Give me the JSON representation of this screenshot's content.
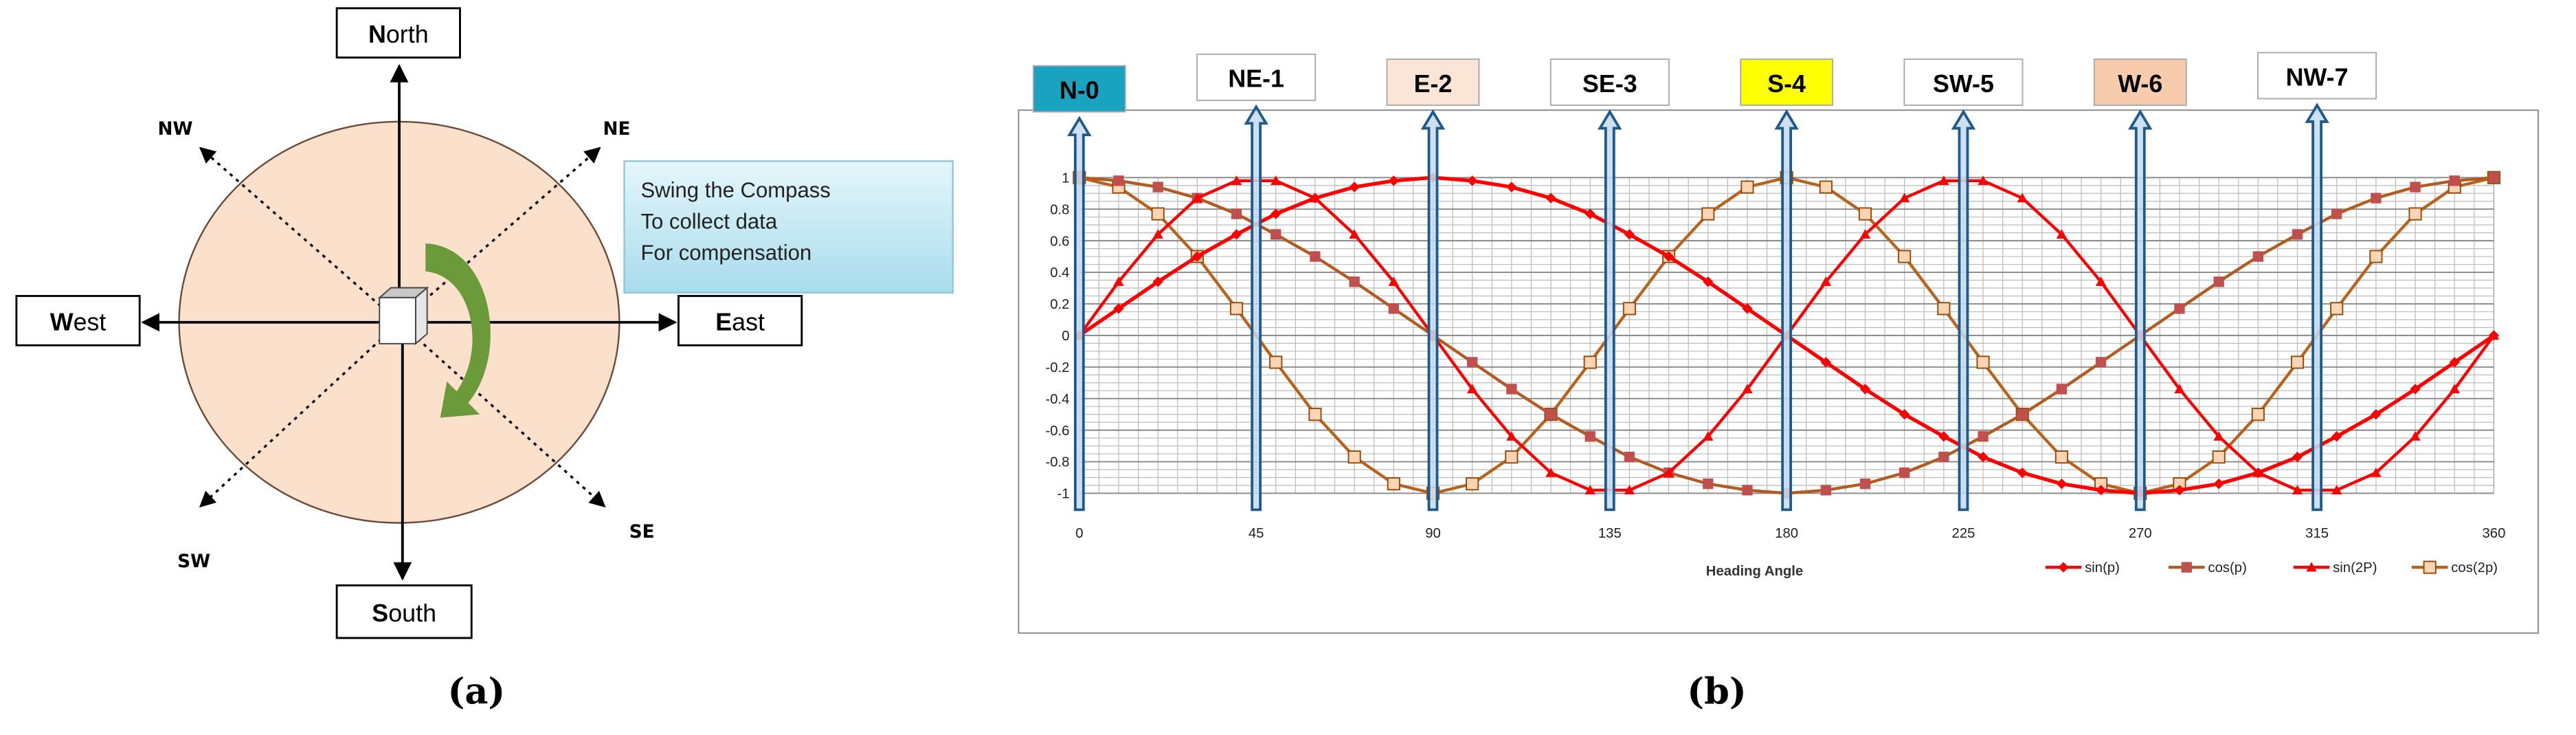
{
  "panel_a": {
    "caption": "(a)",
    "directions": {
      "north": {
        "first": "N",
        "rest": "orth"
      },
      "south": {
        "first": "S",
        "rest": "outh"
      },
      "east": {
        "first": "E",
        "rest": "ast"
      },
      "west": {
        "first": "W",
        "rest": "est"
      }
    },
    "diagonals": {
      "nw": "NW",
      "ne": "NE",
      "sw": "SW",
      "se": "SE"
    },
    "callout": [
      "Swing the Compass",
      "To collect data",
      "For compensation"
    ],
    "colors": {
      "disc": "#fbe0cc",
      "rotation_arrow": "#6a9a3a",
      "callout": "#bfe6f2"
    }
  },
  "panel_b": {
    "caption": "(b)"
  },
  "chart_data": {
    "type": "line",
    "title": "",
    "xlabel": "Heading Angle",
    "ylabel": "",
    "xlim": [
      0,
      360
    ],
    "ylim": [
      -1,
      1
    ],
    "x_ticks": [
      "0",
      "45",
      "90",
      "135",
      "180",
      "225",
      "270",
      "315",
      "360"
    ],
    "y_ticks": [
      "1",
      "0.8",
      "0.6",
      "0.4",
      "0.2",
      "0",
      "-0.2",
      "-0.4",
      "-0.6",
      "-0.8",
      "-1"
    ],
    "grid": true,
    "legend": "bottom-right",
    "x": [
      0,
      10,
      20,
      30,
      40,
      50,
      60,
      70,
      80,
      90,
      100,
      110,
      120,
      130,
      140,
      150,
      160,
      170,
      180,
      190,
      200,
      210,
      220,
      230,
      240,
      250,
      260,
      270,
      280,
      290,
      300,
      310,
      320,
      330,
      340,
      350,
      360
    ],
    "series": [
      {
        "name": "sin(p)",
        "marker": "diamond",
        "color": "#ff0000",
        "marker_fill": "#ff0000",
        "values": [
          0,
          0.17,
          0.34,
          0.5,
          0.64,
          0.77,
          0.87,
          0.94,
          0.98,
          1,
          0.98,
          0.94,
          0.87,
          0.77,
          0.64,
          0.5,
          0.34,
          0.17,
          0,
          -0.17,
          -0.34,
          -0.5,
          -0.64,
          -0.77,
          -0.87,
          -0.94,
          -0.98,
          -1,
          -0.98,
          -0.94,
          -0.87,
          -0.77,
          -0.64,
          -0.5,
          -0.34,
          -0.17,
          0
        ]
      },
      {
        "name": "cos(p)",
        "marker": "square",
        "color": "#b35a1f",
        "marker_fill": "#c0504d",
        "values": [
          1,
          0.98,
          0.94,
          0.87,
          0.77,
          0.64,
          0.5,
          0.34,
          0.17,
          0,
          -0.17,
          -0.34,
          -0.5,
          -0.64,
          -0.77,
          -0.87,
          -0.94,
          -0.98,
          -1,
          -0.98,
          -0.94,
          -0.87,
          -0.77,
          -0.64,
          -0.5,
          -0.34,
          -0.17,
          0,
          0.17,
          0.34,
          0.5,
          0.64,
          0.77,
          0.87,
          0.94,
          0.98,
          1
        ]
      },
      {
        "name": "sin(2P)",
        "marker": "triangle",
        "color": "#ff0000",
        "marker_fill": "#ff0000",
        "values": [
          0,
          0.34,
          0.64,
          0.87,
          0.98,
          0.98,
          0.87,
          0.64,
          0.34,
          0,
          -0.34,
          -0.64,
          -0.87,
          -0.98,
          -0.98,
          -0.87,
          -0.64,
          -0.34,
          0,
          0.34,
          0.64,
          0.87,
          0.98,
          0.98,
          0.87,
          0.64,
          0.34,
          0,
          -0.34,
          -0.64,
          -0.87,
          -0.98,
          -0.98,
          -0.87,
          -0.64,
          -0.34,
          0
        ]
      },
      {
        "name": "cos(2p)",
        "marker": "open-square",
        "color": "#b8621b",
        "marker_fill": "#fcd5b4",
        "values": [
          1,
          0.94,
          0.77,
          0.5,
          0.17,
          -0.17,
          -0.5,
          -0.77,
          -0.94,
          -1,
          -0.94,
          -0.77,
          -0.5,
          -0.17,
          0.17,
          0.5,
          0.77,
          0.94,
          1,
          0.94,
          0.77,
          0.5,
          0.17,
          -0.17,
          -0.5,
          -0.77,
          -0.94,
          -1,
          -0.94,
          -0.77,
          -0.5,
          -0.17,
          0.17,
          0.5,
          0.77,
          0.94,
          1
        ]
      }
    ],
    "heading_markers": [
      {
        "label": "N-0",
        "angle": 0,
        "fill": "#1aa3c0"
      },
      {
        "label": "NE-1",
        "angle": 45,
        "fill": "#ffffff"
      },
      {
        "label": "E-2",
        "angle": 90,
        "fill": "#fbe5d6"
      },
      {
        "label": "SE-3",
        "angle": 135,
        "fill": "#ffffff"
      },
      {
        "label": "S-4",
        "angle": 180,
        "fill": "#ffff00"
      },
      {
        "label": "SW-5",
        "angle": 225,
        "fill": "#ffffff"
      },
      {
        "label": "W-6",
        "angle": 270,
        "fill": "#f8cbad"
      },
      {
        "label": "NW-7",
        "angle": 315,
        "fill": "#ffffff"
      }
    ]
  }
}
